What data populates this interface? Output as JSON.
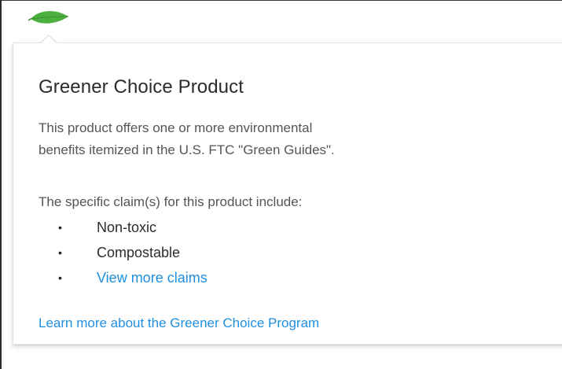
{
  "popover": {
    "title": "Greener Choice Product",
    "description_line_1": "This product offers one or more environmental",
    "description_line_2": "benefits itemized in the U.S. FTC \"Green Guides\".",
    "claims_intro": "The specific claim(s) for this product include:",
    "claims": [
      {
        "label": "Non-toxic"
      },
      {
        "label": "Compostable"
      }
    ],
    "view_more_label": "View more claims",
    "learn_more_label": "Learn more about the Greener Choice Program"
  },
  "icons": {
    "leaf": "leaf-icon",
    "bullet": "•"
  },
  "colors": {
    "accent_green": "#4caf3f",
    "link_blue": "#1f8fe0",
    "title_text": "#2b2b2b",
    "body_text": "#555555"
  }
}
